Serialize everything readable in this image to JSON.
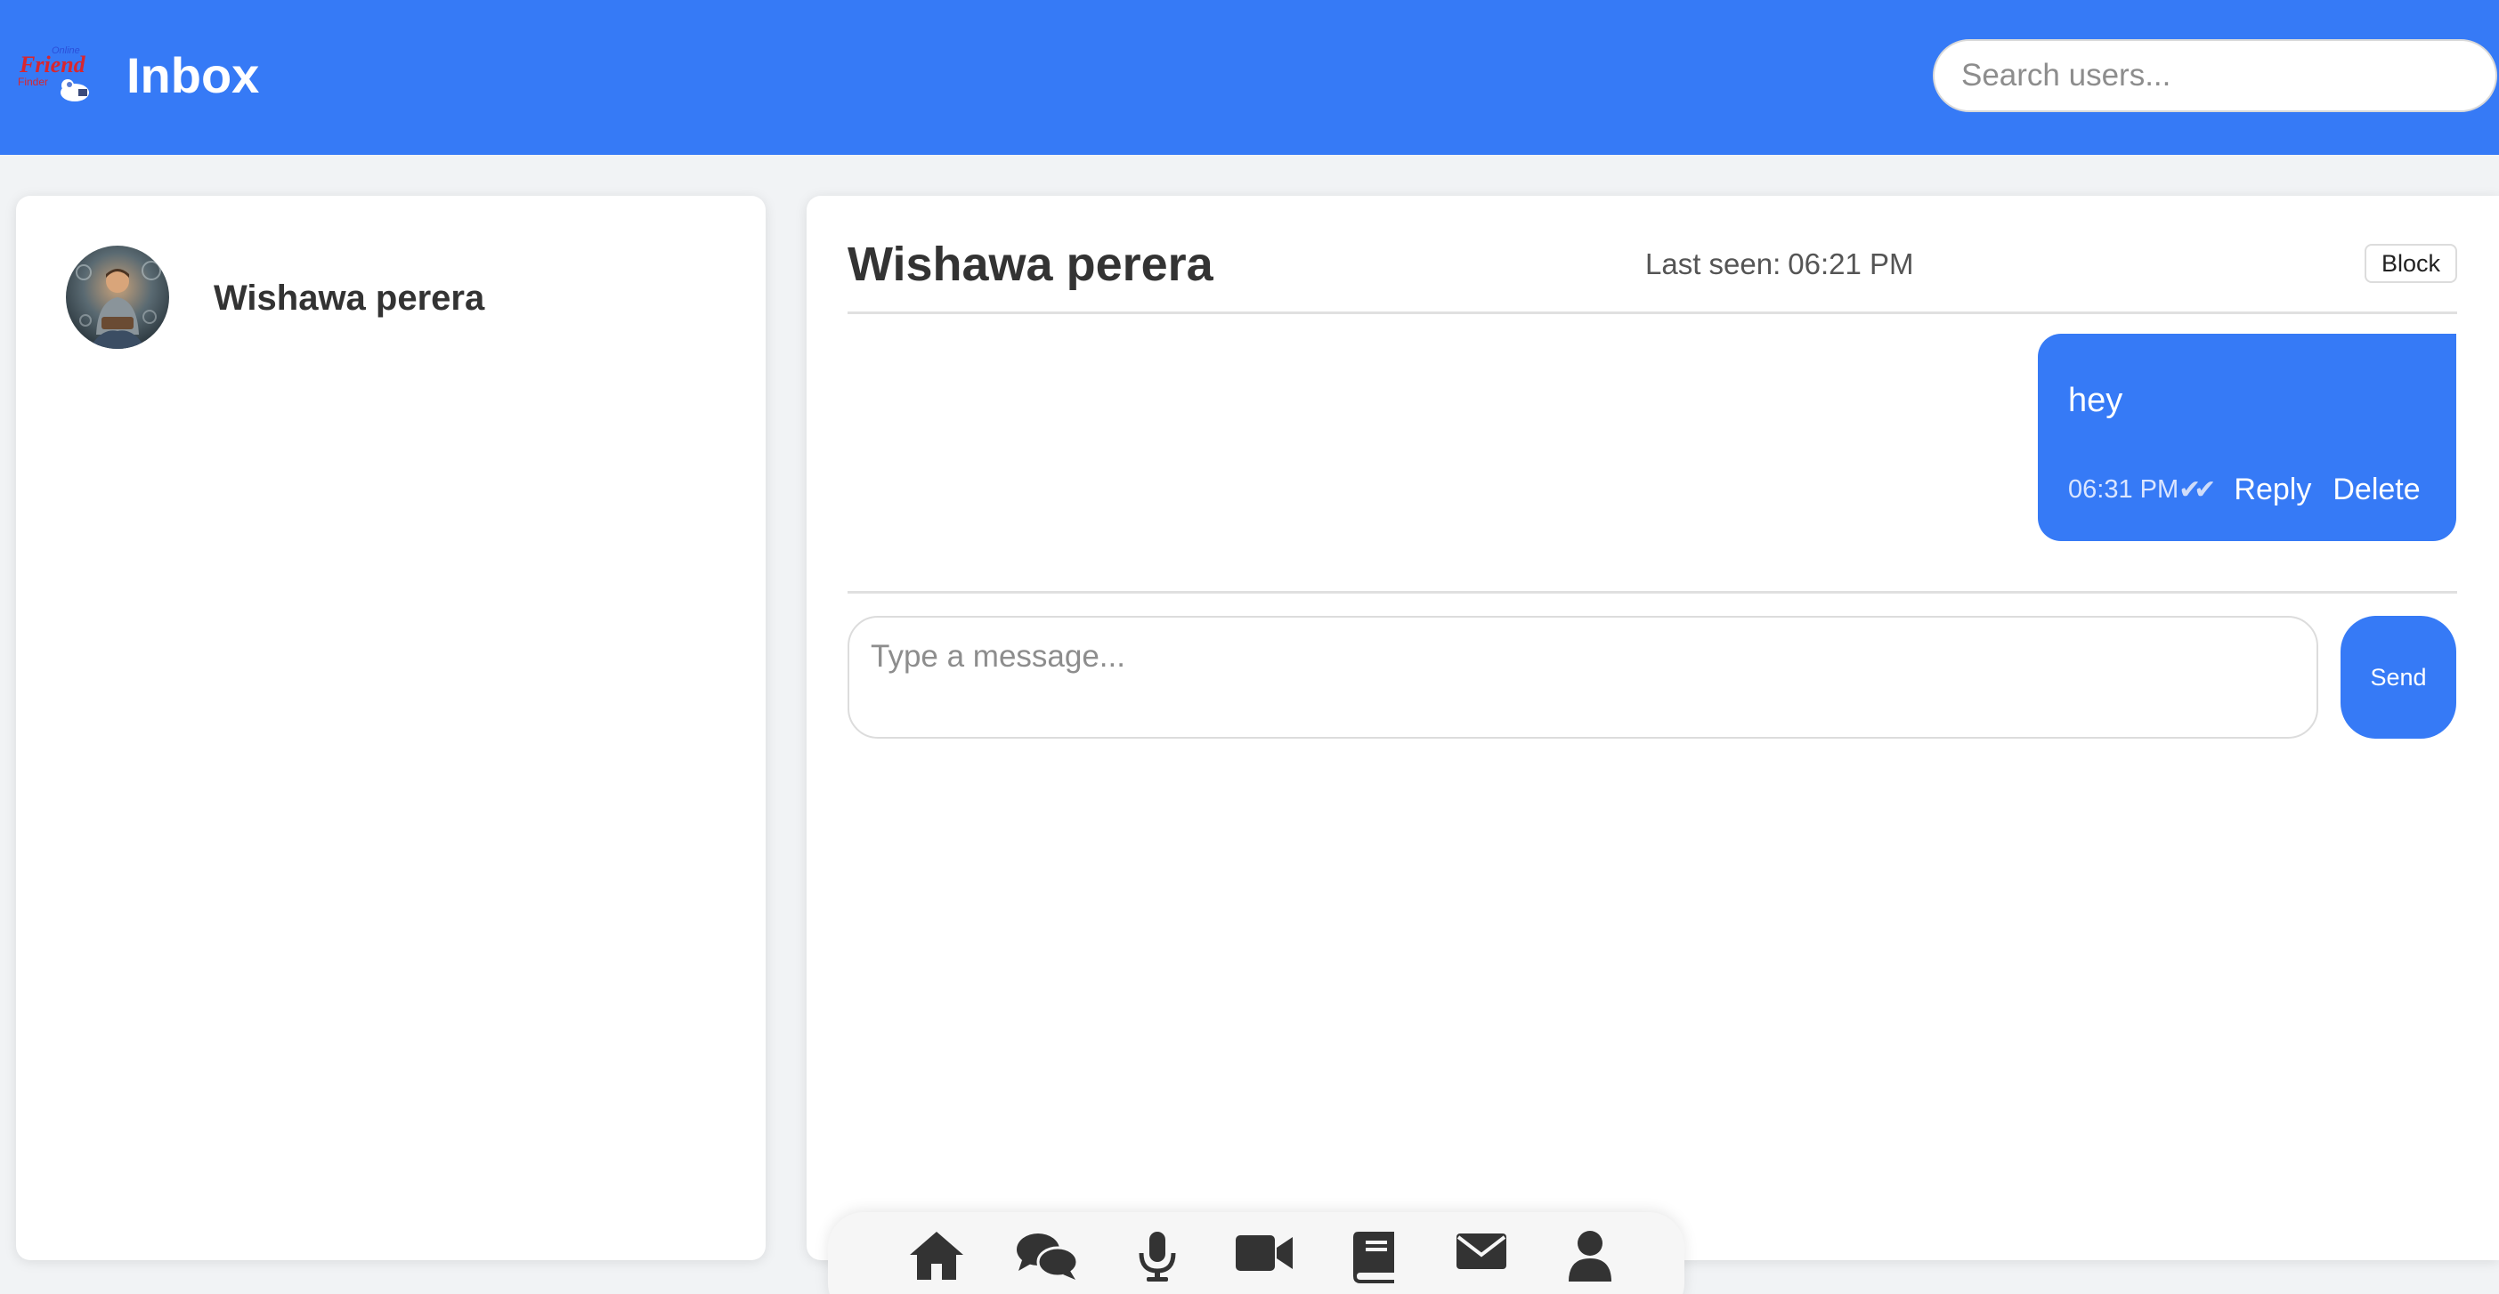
{
  "header": {
    "title": "Inbox",
    "search_placeholder": "Search users...",
    "logo_text_top": "Online",
    "logo_text_main": "Friend",
    "logo_text_bottom": "Finder",
    "background_color": "#367af6"
  },
  "contacts": [
    {
      "name": "Wishawa perera",
      "avatar_icon": "user-avatar"
    }
  ],
  "chat": {
    "name": "Wishawa perera",
    "last_seen_label": "Last seen:",
    "last_seen_time": "06:21 PM",
    "block_label": "Block",
    "messages": [
      {
        "text": "hey",
        "time": "06:31 PM",
        "status_ticks": "✔✔",
        "reply_label": "Reply",
        "delete_label": "Delete",
        "sender": "me"
      }
    ],
    "composer": {
      "placeholder": "Type a message...",
      "send_label": "Send"
    }
  },
  "bottom_nav": {
    "items": [
      {
        "icon": "home-icon"
      },
      {
        "icon": "chat-icon"
      },
      {
        "icon": "microphone-icon"
      },
      {
        "icon": "video-icon"
      },
      {
        "icon": "book-icon"
      },
      {
        "icon": "mail-icon"
      },
      {
        "icon": "user-icon"
      }
    ]
  },
  "colors": {
    "accent": "#367af6",
    "panel_background": "#ffffff",
    "page_background": "#f1f3f5",
    "text": "#333333"
  }
}
